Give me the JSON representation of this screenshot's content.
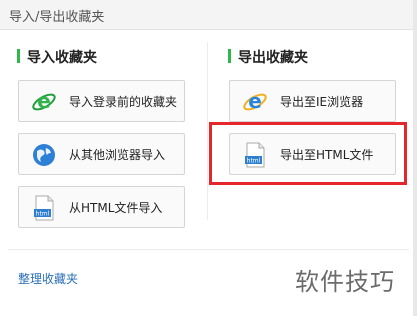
{
  "window": {
    "title": "导入/导出收藏夹"
  },
  "import_section": {
    "heading": "导入收藏夹",
    "buttons": [
      {
        "label": "导入登录前的收藏夹",
        "icon": "ie-logo-icon"
      },
      {
        "label": "从其他浏览器导入",
        "icon": "globe-icon"
      },
      {
        "label": "从HTML文件导入",
        "icon": "html-file-icon"
      }
    ]
  },
  "export_section": {
    "heading": "导出收藏夹",
    "buttons": [
      {
        "label": "导出至IE浏览器",
        "icon": "ie-logo-icon"
      },
      {
        "label": "导出至HTML文件",
        "icon": "html-file-icon"
      }
    ]
  },
  "footer": {
    "link_label": "整理收藏夹"
  },
  "watermark": {
    "text": "软件技巧"
  },
  "colors": {
    "accent_bar": "#2db84d",
    "highlight": "#e5262a",
    "link": "#2a6fb8"
  }
}
